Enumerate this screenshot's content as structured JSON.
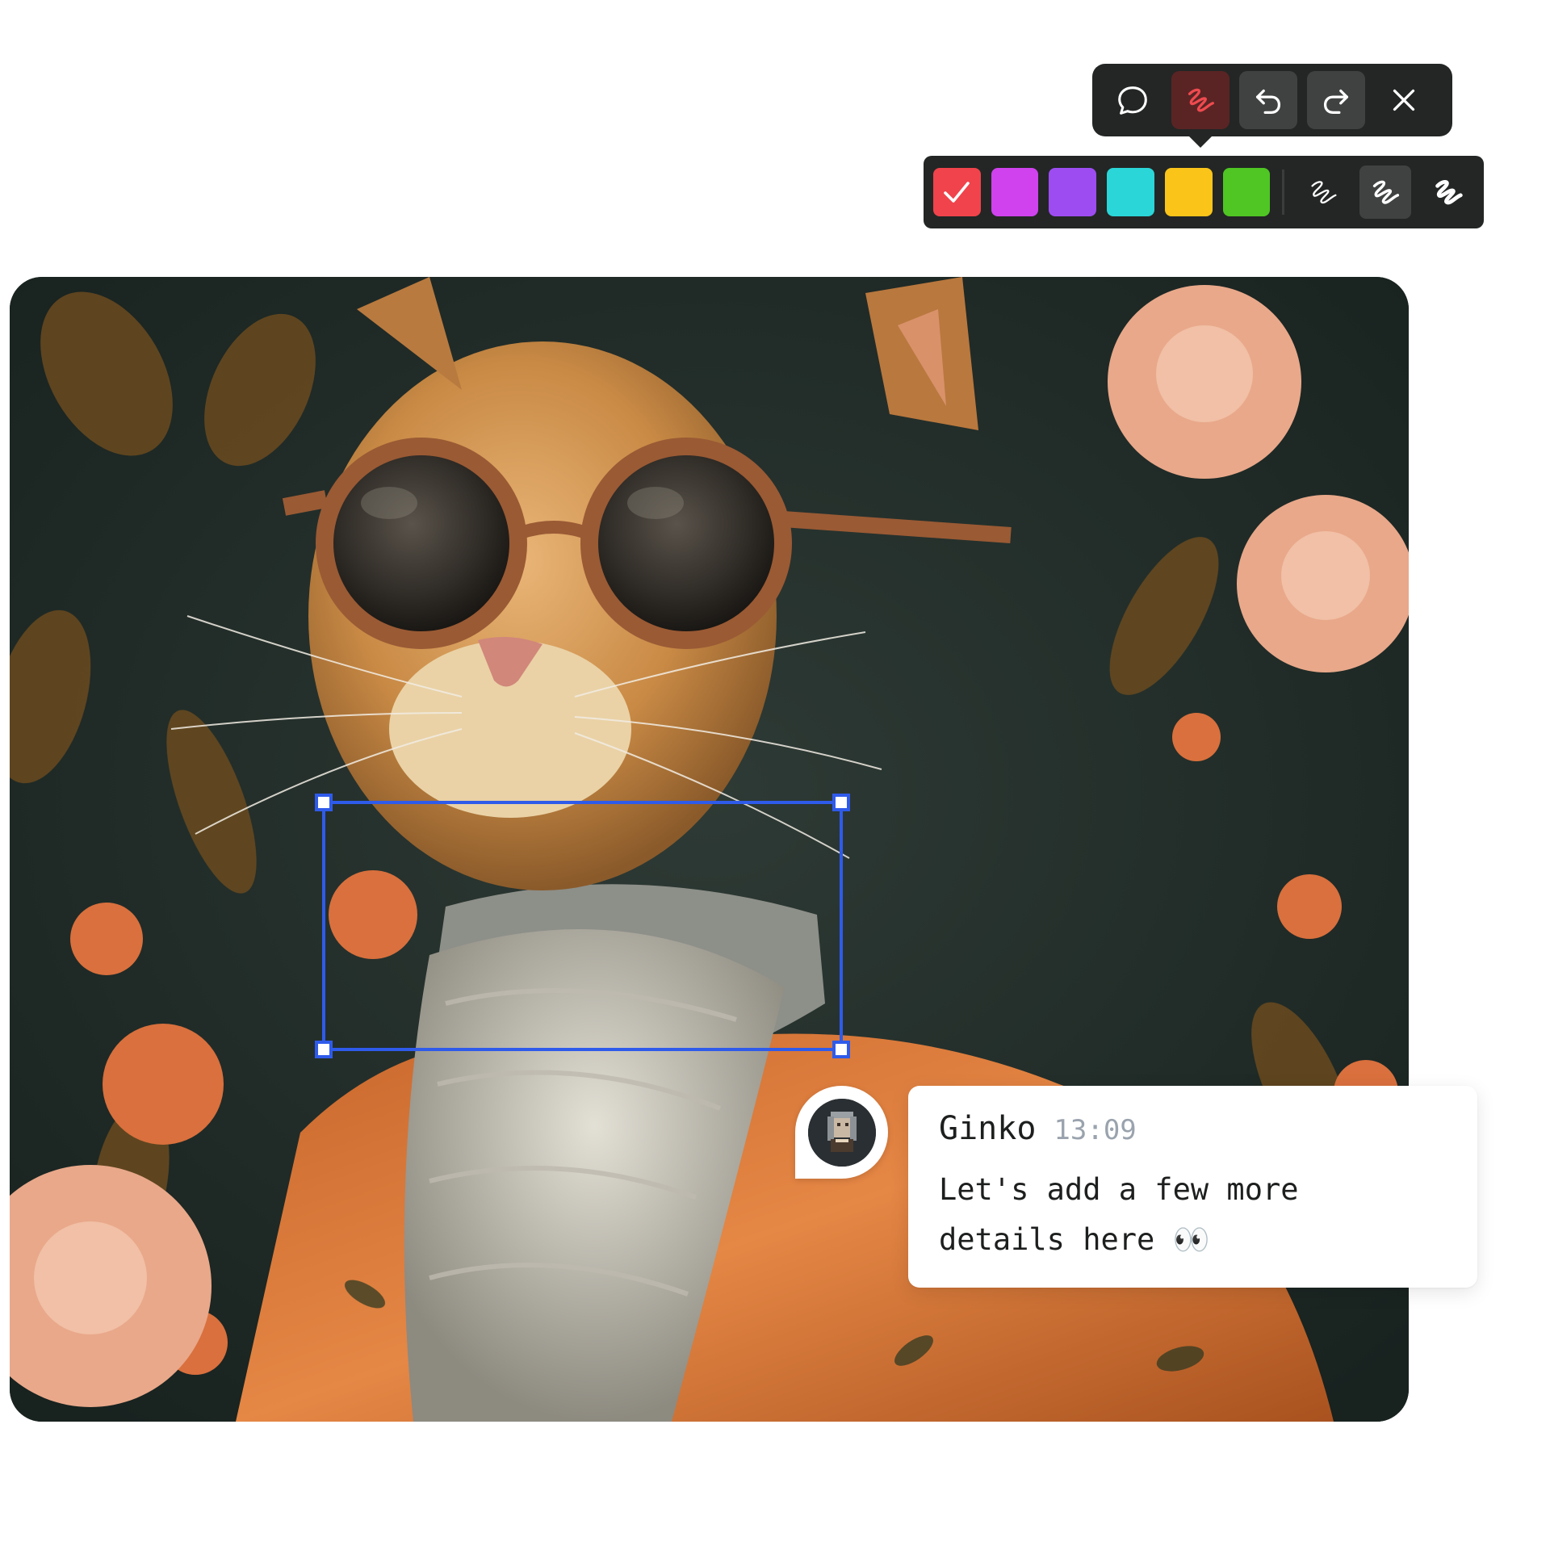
{
  "toolbar": {
    "tools": [
      {
        "id": "comment",
        "icon": "comment-bubble-icon",
        "active": false
      },
      {
        "id": "draw",
        "icon": "scribble-icon",
        "active": true
      },
      {
        "id": "undo",
        "icon": "undo-icon",
        "active": false
      },
      {
        "id": "redo",
        "icon": "redo-icon",
        "active": false
      },
      {
        "id": "close",
        "icon": "close-icon",
        "active": false
      }
    ],
    "active_color": "#e8454b"
  },
  "palette": {
    "colors": [
      {
        "name": "red",
        "hex": "#f0434b",
        "selected": true
      },
      {
        "name": "magenta",
        "hex": "#cf42ee"
      },
      {
        "name": "purple",
        "hex": "#9d4cf2"
      },
      {
        "name": "cyan",
        "hex": "#2bd6d8"
      },
      {
        "name": "yellow",
        "hex": "#fbc419"
      },
      {
        "name": "green",
        "hex": "#4fc623"
      }
    ],
    "stroke_widths": [
      {
        "name": "thin",
        "icon": "scribble-thin-icon"
      },
      {
        "name": "medium",
        "icon": "scribble-medium-icon",
        "selected": true
      },
      {
        "name": "thick",
        "icon": "scribble-thick-icon"
      }
    ]
  },
  "selection": {
    "color": "#2f5bea"
  },
  "comment": {
    "author": "Ginko",
    "time": "13:09",
    "text": "Let's add a few more details here 👀"
  }
}
